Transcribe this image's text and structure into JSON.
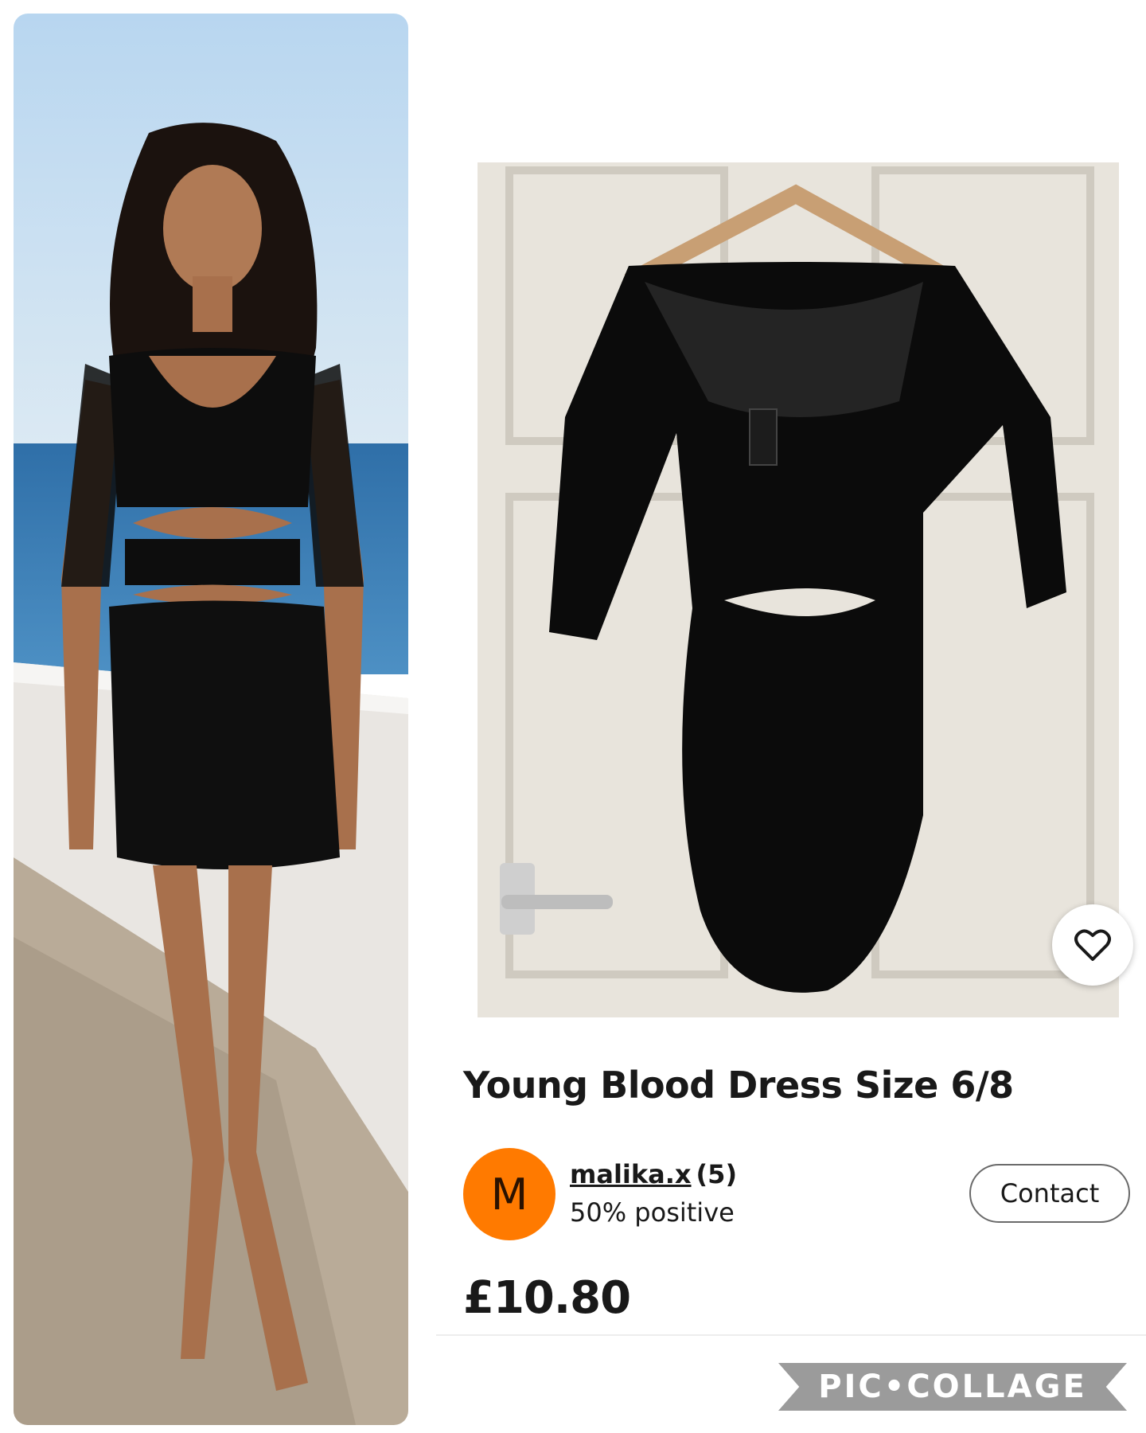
{
  "listing": {
    "title": "Young Blood Dress Size 6/8",
    "price": "£10.80",
    "favorite_icon": "heart-outline-icon"
  },
  "seller": {
    "avatar_letter": "M",
    "avatar_color": "#ff7a00",
    "username": "malika.x",
    "review_count": "(5)",
    "feedback": "50% positive",
    "contact_label": "Contact"
  },
  "watermark": {
    "text": "PIC•COLLAGE"
  }
}
